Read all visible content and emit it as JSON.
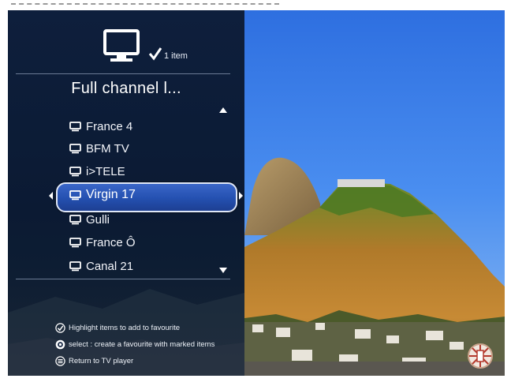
{
  "header": {
    "selected_count_label": "1 item"
  },
  "menu": {
    "title": "Full channel l...",
    "channels": [
      {
        "label": "France 4"
      },
      {
        "label": "BFM TV"
      },
      {
        "label": "i>TELE"
      },
      {
        "label": "Virgin 17",
        "selected": true
      },
      {
        "label": "Gulli"
      },
      {
        "label": "France Ô"
      },
      {
        "label": "Canal 21"
      }
    ]
  },
  "help": {
    "highlight": "Highlight items to add to favourite",
    "select": "select : create a favourite with marked items",
    "return": "Return to TV player"
  },
  "icons": {
    "tv": "tv-icon",
    "check": "check-icon",
    "monitor": "monitor-icon",
    "scroll_up": "scroll-up-icon",
    "scroll_down": "scroll-down-icon",
    "ok": "ok-button-icon",
    "menu": "menu-button-icon",
    "brand": "brand-logo-icon"
  },
  "colors": {
    "menu_bg": "#0e1f3c",
    "selection": "#2a56b8",
    "text": "#ffffff"
  }
}
